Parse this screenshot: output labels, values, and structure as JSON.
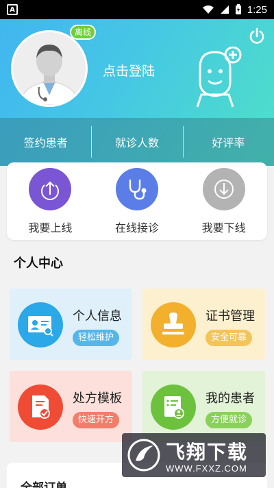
{
  "status_bar": {
    "app_icon": "A",
    "time": "1:25",
    "icons": [
      "wifi-icon",
      "signal-icon",
      "battery-icon"
    ]
  },
  "header": {
    "badge": "离线",
    "login_text": "点击登陆",
    "power_icon": "power-icon",
    "mascot_icon": "doctor-mascot-icon",
    "gradient": [
      "#41b6f0",
      "#4fe0c8"
    ]
  },
  "stats": {
    "items": [
      {
        "label": "签约患者"
      },
      {
        "label": "就诊人数"
      },
      {
        "label": "好评率"
      }
    ]
  },
  "actions": [
    {
      "label": "我要上线",
      "icon": "upload-icon",
      "color": "#7a56d4"
    },
    {
      "label": "在线接诊",
      "icon": "stethoscope-icon",
      "color": "#5b7de8"
    },
    {
      "label": "我要下线",
      "icon": "download-icon",
      "color": "#b3b3b3"
    }
  ],
  "personal_center": {
    "title": "个人中心",
    "cards": [
      {
        "title": "个人信息",
        "pill": "轻松维护",
        "icon": "id-card-icon",
        "bg": "#e0f0fb",
        "circle": "#2aa8e8",
        "pill_color": "#54b6ea"
      },
      {
        "title": "证书管理",
        "pill": "安全可靠",
        "icon": "stamp-icon",
        "bg": "#fdf0cf",
        "circle": "#f2b02d",
        "pill_color": "#f3c45a"
      },
      {
        "title": "处方模板",
        "pill": "快速开方",
        "icon": "prescription-icon",
        "bg": "#fde0dc",
        "circle": "#f04b34",
        "pill_color": "#f27d6a"
      },
      {
        "title": "我的患者",
        "pill": "方便就诊",
        "icon": "patient-list-icon",
        "bg": "#e2f3d7",
        "circle": "#6cc23c",
        "pill_color": "#8ad15c"
      }
    ]
  },
  "orders": {
    "title": "全部订单"
  },
  "watermark": {
    "main": "飞翔下载",
    "url": "WWW.FXXZ.COM"
  }
}
